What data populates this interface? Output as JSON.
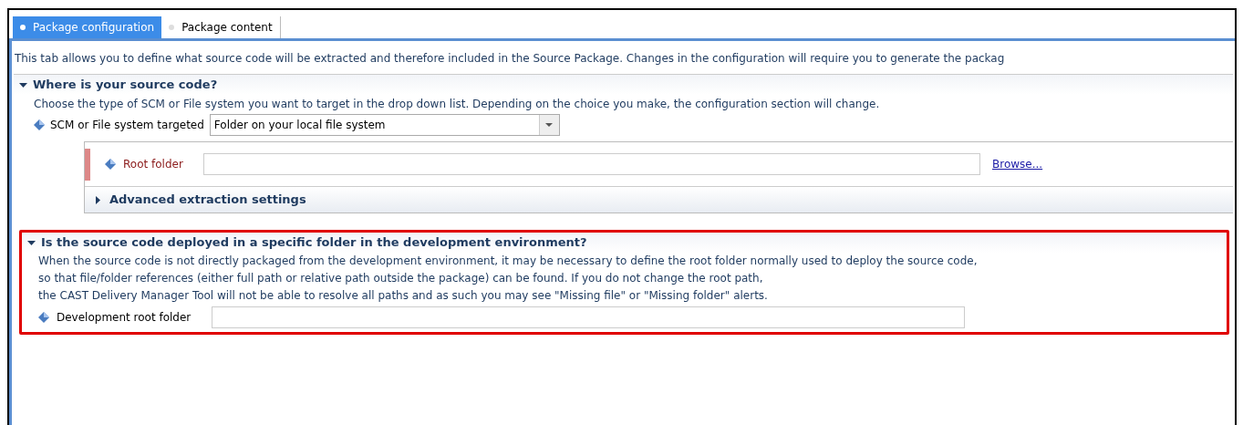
{
  "tabs": [
    {
      "label": "Package configuration",
      "selected": true
    },
    {
      "label": "Package content",
      "selected": false
    }
  ],
  "intro": "This tab allows you to define what source code will be extracted and therefore included in the Source Package. Changes in the configuration will require you to generate the packag",
  "source_section": {
    "title": "Where is your source code?",
    "expanded": true,
    "description": "Choose the type of SCM or File system you want to target in the drop down list. Depending on the choice you make, the configuration section will change.",
    "scm_label": "SCM or File system targeted",
    "scm_value": "Folder on your local file system",
    "root_folder": {
      "label": "Root folder",
      "required": true,
      "browse": "Browse..."
    },
    "advanced": {
      "title": "Advanced extraction settings",
      "expanded": false
    }
  },
  "deploy_section": {
    "title": "Is the source code deployed in a specific folder in the development environment?",
    "expanded": true,
    "highlighted": true,
    "description_lines": [
      "When the source code is not directly packaged from the development environment, it may be necessary to define the root folder normally used to deploy the source code,",
      "so that file/folder references (either full path or relative path outside the package) can be found. If you do not change the root path,",
      "the CAST Delivery Manager Tool will not be able to resolve all paths and as such you may see \"Missing file\" or \"Missing folder\" alerts."
    ],
    "field_label": "Development root folder"
  }
}
